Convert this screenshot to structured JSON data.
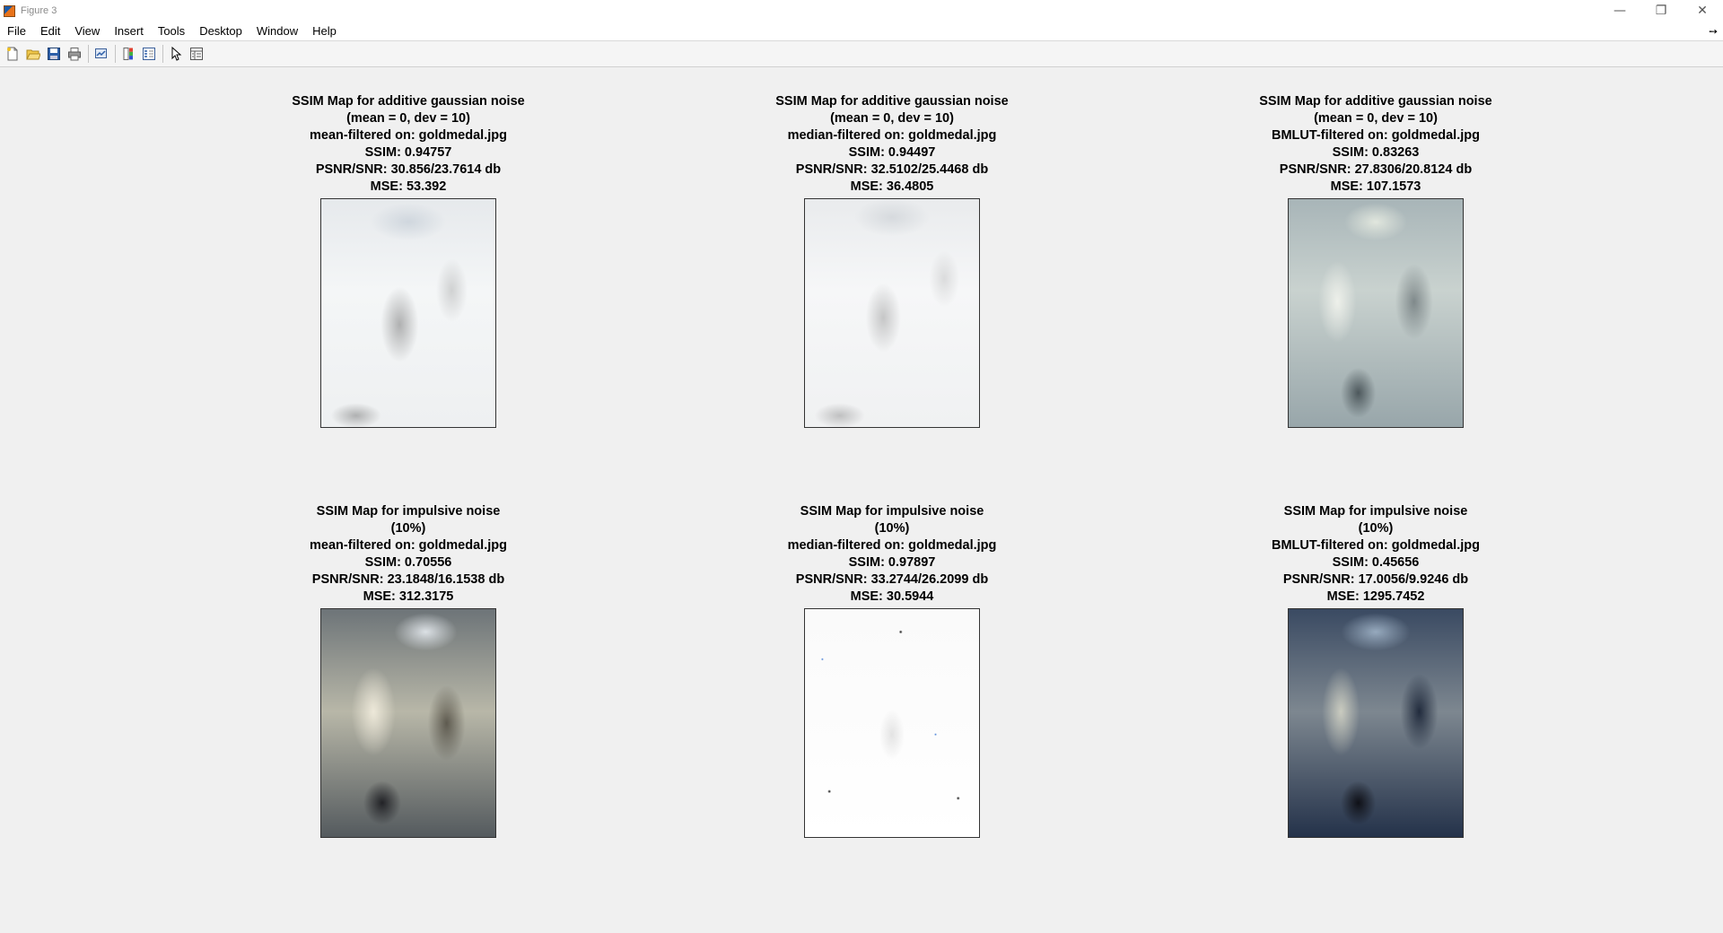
{
  "window": {
    "title": "Figure 3",
    "controls": {
      "minimize": "—",
      "restore": "❐",
      "close": "✕"
    }
  },
  "menu": [
    "File",
    "Edit",
    "View",
    "Insert",
    "Tools",
    "Desktop",
    "Window",
    "Help"
  ],
  "toolbar": {
    "icons": [
      "new-figure-icon",
      "open-file-icon",
      "save-icon",
      "print-icon",
      "link-plot-icon",
      "colorbar-icon",
      "legend-icon",
      "edit-plot-arrow-icon",
      "property-inspector-icon"
    ]
  },
  "subplots": [
    {
      "lines": [
        "SSIM Map for additive gaussian noise",
        "(mean = 0, dev = 10)",
        "mean-filtered on: goldmedal.jpg",
        "SSIM: 0.94757",
        "PSNR/SNR: 30.856/23.7614 db",
        "MSE: 53.392"
      ]
    },
    {
      "lines": [
        "SSIM Map for additive gaussian noise",
        "(mean = 0, dev = 10)",
        "median-filtered on: goldmedal.jpg",
        "SSIM: 0.94497",
        "PSNR/SNR: 32.5102/25.4468 db",
        "MSE: 36.4805"
      ]
    },
    {
      "lines": [
        "SSIM Map for additive gaussian noise",
        "(mean = 0, dev = 10)",
        "BMLUT-filtered on: goldmedal.jpg",
        "SSIM: 0.83263",
        "PSNR/SNR: 27.8306/20.8124 db",
        "MSE: 107.1573"
      ]
    },
    {
      "lines": [
        "SSIM Map for impulsive noise",
        "(10%)",
        "mean-filtered on: goldmedal.jpg",
        "SSIM: 0.70556",
        "PSNR/SNR: 23.1848/16.1538 db",
        "MSE: 312.3175"
      ]
    },
    {
      "lines": [
        "SSIM Map for impulsive noise",
        "(10%)",
        "median-filtered on: goldmedal.jpg",
        "SSIM: 0.97897",
        "PSNR/SNR: 33.2744/26.2099 db",
        "MSE: 30.5944"
      ]
    },
    {
      "lines": [
        "SSIM Map for impulsive noise",
        "(10%)",
        "BMLUT-filtered on: goldmedal.jpg",
        "SSIM: 0.45656",
        "PSNR/SNR: 17.0056/9.9246 db",
        "MSE: 1295.7452"
      ]
    }
  ]
}
